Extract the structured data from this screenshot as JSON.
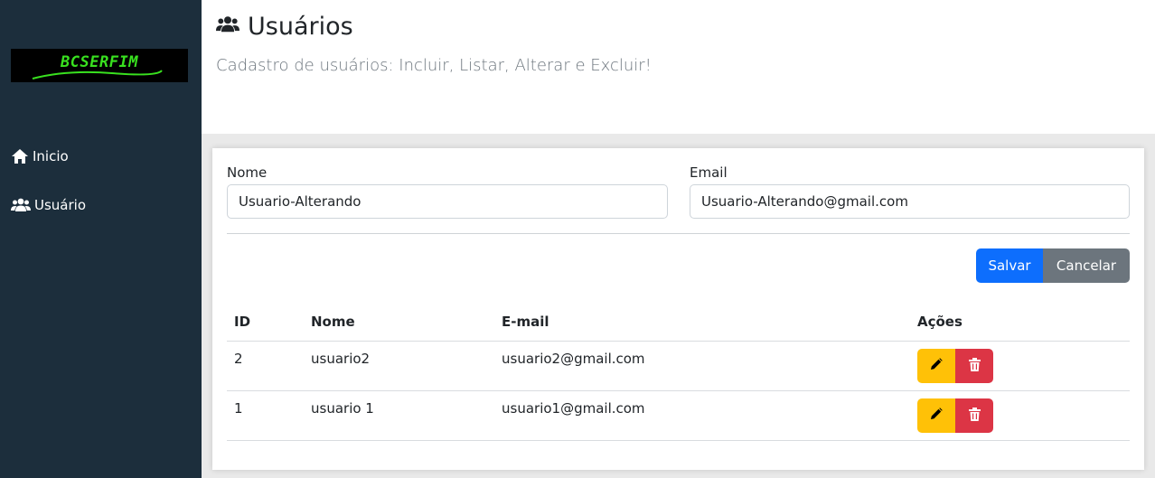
{
  "sidebar": {
    "logo_text": "BCSERFIM",
    "items": [
      {
        "label": "Inicio",
        "icon": "home-icon"
      },
      {
        "label": "Usuário",
        "icon": "users-icon"
      }
    ]
  },
  "header": {
    "title": "Usuários",
    "subtitle": "Cadastro de usuários: Incluir, Listar, Alterar e Excluir!"
  },
  "form": {
    "name_label": "Nome",
    "name_value": "Usuario-Alterando",
    "email_label": "Email",
    "email_value": "Usuario-Alterando@gmail.com",
    "save_label": "Salvar",
    "cancel_label": "Cancelar"
  },
  "table": {
    "headers": [
      "ID",
      "Nome",
      "E-mail",
      "Ações"
    ],
    "rows": [
      {
        "id": "2",
        "name": "usuario2",
        "email": "usuario2@gmail.com"
      },
      {
        "id": "1",
        "name": "usuario 1",
        "email": "usuario1@gmail.com"
      }
    ]
  },
  "colors": {
    "sidebar_bg": "#1c2e3c",
    "primary": "#0d6efd",
    "secondary": "#6c757d",
    "warning": "#ffc107",
    "danger": "#dc3545",
    "logo_green": "#39e11f"
  }
}
